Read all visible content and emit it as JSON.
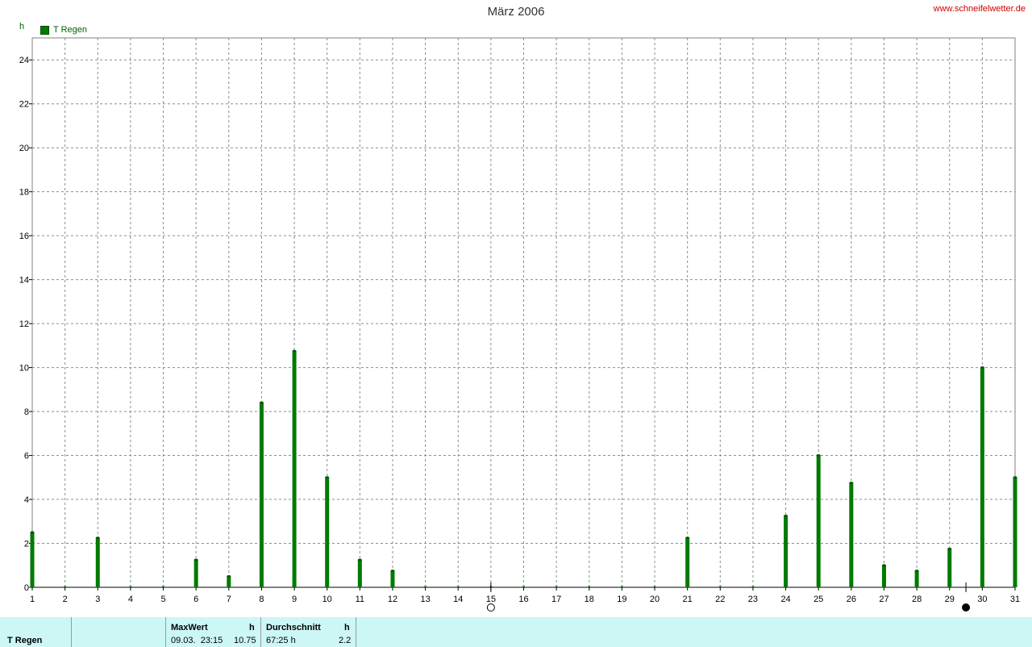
{
  "header": {
    "title": "März 2006",
    "site": "www.schneifelwetter.de",
    "unit": "h"
  },
  "legend": {
    "label": "T Regen",
    "color": "#007a00"
  },
  "chart_data": {
    "type": "bar",
    "title": "März 2006",
    "ylabel": "h",
    "xlabel": "",
    "ylim": [
      0,
      25
    ],
    "y_ticks": [
      0,
      2,
      4,
      6,
      8,
      10,
      12,
      14,
      16,
      18,
      20,
      22,
      24
    ],
    "categories": [
      "1",
      "2",
      "3",
      "4",
      "5",
      "6",
      "7",
      "8",
      "9",
      "10",
      "11",
      "12",
      "13",
      "14",
      "15",
      "16",
      "17",
      "18",
      "19",
      "20",
      "21",
      "22",
      "23",
      "24",
      "25",
      "26",
      "27",
      "28",
      "29",
      "30",
      "31"
    ],
    "series": [
      {
        "name": "T Regen",
        "values": [
          2.5,
          0,
          2.25,
          0,
          0,
          1.25,
          0.5,
          8.4,
          10.75,
          5.0,
          1.25,
          0.75,
          0,
          0,
          0,
          0,
          0,
          0,
          0,
          0,
          2.25,
          0,
          0,
          3.25,
          6.0,
          4.75,
          1.0,
          0.75,
          1.75,
          10.0,
          5.0
        ]
      }
    ],
    "grid": true,
    "legend_position": "top-left",
    "moon_phases": [
      {
        "day": 15,
        "phase": "full"
      },
      {
        "day": 29.5,
        "phase": "new"
      }
    ]
  },
  "footer": {
    "row_label": "T Regen",
    "max_header": "MaxWert",
    "max_unit": "h",
    "max_date": "09.03.  23:15",
    "max_value": "10.75",
    "avg_header": "Durchschnitt",
    "avg_unit": "h",
    "avg_total": "67:25 h",
    "avg_value": "2.2"
  }
}
